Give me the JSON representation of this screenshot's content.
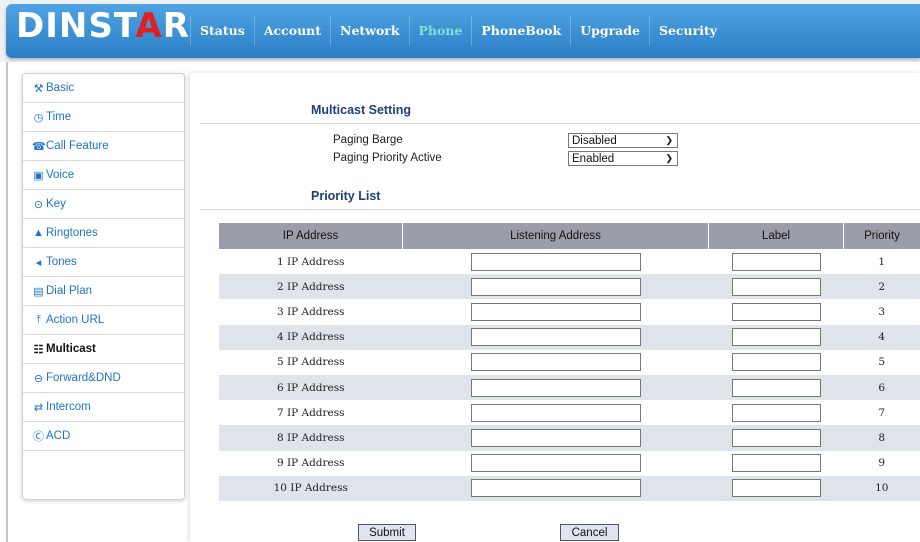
{
  "header": {
    "logo_main": "DINST",
    "logo_accent": "A",
    "logo_end": "R",
    "nav": [
      "Status",
      "Account",
      "Network",
      "Phone",
      "PhoneBook",
      "Upgrade",
      "Security"
    ],
    "active_nav": "Phone"
  },
  "sidebar": {
    "items": [
      {
        "label": "Basic",
        "icon": "wrench-icon"
      },
      {
        "label": "Time",
        "icon": "clock-icon"
      },
      {
        "label": "Call Feature",
        "icon": "phone-icon"
      },
      {
        "label": "Voice",
        "icon": "voice-icon"
      },
      {
        "label": "Key",
        "icon": "key-icon"
      },
      {
        "label": "Ringtones",
        "icon": "bell-icon"
      },
      {
        "label": "Tones",
        "icon": "speaker-icon"
      },
      {
        "label": "Dial Plan",
        "icon": "list-icon"
      },
      {
        "label": "Action URL",
        "icon": "upload-icon"
      },
      {
        "label": "Multicast",
        "icon": "multicast-icon",
        "active": true
      },
      {
        "label": "Forward&DND",
        "icon": "minus-circle-icon"
      },
      {
        "label": "Intercom",
        "icon": "arrows-icon"
      },
      {
        "label": "ACD",
        "icon": "acd-icon"
      }
    ]
  },
  "multicast": {
    "title": "Multicast Setting",
    "paging_barge_label": "Paging Barge",
    "paging_barge_value": "Disabled",
    "paging_priority_label": "Paging Priority Active",
    "paging_priority_value": "Enabled"
  },
  "priority_list": {
    "title": "Priority List",
    "columns": [
      "IP Address",
      "Listening Address",
      "Label",
      "Priority"
    ],
    "rows": [
      {
        "ip": "1 IP Address",
        "priority": "1"
      },
      {
        "ip": "2 IP Address",
        "priority": "2"
      },
      {
        "ip": "3 IP Address",
        "priority": "3"
      },
      {
        "ip": "4 IP Address",
        "priority": "4"
      },
      {
        "ip": "5 IP Address",
        "priority": "5"
      },
      {
        "ip": "6 IP Address",
        "priority": "6"
      },
      {
        "ip": "7 IP Address",
        "priority": "7"
      },
      {
        "ip": "8 IP Address",
        "priority": "8"
      },
      {
        "ip": "9 IP Address",
        "priority": "9"
      },
      {
        "ip": "10 IP Address",
        "priority": "10"
      }
    ]
  },
  "buttons": {
    "submit": "Submit",
    "cancel": "Cancel"
  }
}
